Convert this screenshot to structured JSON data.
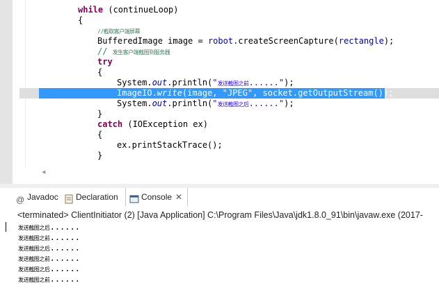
{
  "editor": {
    "lines": [
      {
        "parts": [
          {
            "t": "while",
            "c": "kw"
          },
          {
            "t": " (continueLoop)"
          }
        ]
      },
      {
        "parts": [
          {
            "t": "{"
          }
        ]
      },
      {
        "parts": [
          {
            "t": "//截取客户端屏幕",
            "c": "cm cn"
          }
        ]
      },
      {
        "parts": [
          {
            "t": "BufferedImage image = "
          },
          {
            "t": "robot",
            "c": "fd2"
          },
          {
            "t": ".createScreenCapture("
          },
          {
            "t": "rectangle",
            "c": "fd2"
          },
          {
            "t": ");"
          }
        ]
      },
      {
        "parts": [
          {
            "t": "// ",
            "c": "cm"
          },
          {
            "t": "发生客户端截图到服务器",
            "c": "cm cn"
          }
        ]
      },
      {
        "parts": [
          {
            "t": "try",
            "c": "kw"
          }
        ]
      },
      {
        "parts": [
          {
            "t": "{"
          }
        ]
      },
      {
        "parts": [
          {
            "t": "System."
          },
          {
            "t": "out",
            "c": "fd"
          },
          {
            "t": ".println("
          },
          {
            "t": "\"",
            "c": "st"
          },
          {
            "t": "发送截图之前",
            "c": "st cn"
          },
          {
            "t": "......\"",
            "c": "st"
          },
          {
            "t": ");"
          }
        ]
      },
      {
        "parts": [
          {
            "t": "ImageIO."
          },
          {
            "t": "write",
            "c": "it"
          },
          {
            "t": "(image, "
          },
          {
            "t": "\"JPEG\"",
            "c": "st"
          },
          {
            "t": ", socket.getOutputStream());"
          }
        ]
      },
      {
        "parts": [
          {
            "t": "System."
          },
          {
            "t": "out",
            "c": "fd"
          },
          {
            "t": ".println("
          },
          {
            "t": "\"",
            "c": "st"
          },
          {
            "t": "发送截图之后",
            "c": "st cn"
          },
          {
            "t": "......\"",
            "c": "st"
          },
          {
            "t": ");"
          }
        ]
      },
      {
        "parts": [
          {
            "t": "}"
          }
        ]
      },
      {
        "parts": [
          {
            "t": "catch",
            "c": "kw"
          },
          {
            "t": " (IOException ex)"
          }
        ]
      },
      {
        "parts": [
          {
            "t": "{"
          }
        ]
      },
      {
        "parts": [
          {
            "t": "ex.printStackTrace();"
          }
        ]
      },
      {
        "parts": [
          {
            "t": "}"
          }
        ]
      }
    ],
    "selected_line": 8,
    "hscroll_arrow": "◀"
  },
  "tabs": [
    {
      "label": "Javadoc",
      "icon": "at-icon"
    },
    {
      "label": "Declaration",
      "icon": "declaration-icon"
    },
    {
      "label": "Console",
      "icon": "console-icon",
      "active": true
    }
  ],
  "console": {
    "close_glyph": "✕",
    "terminated": "<terminated> ClientInitiator (2) [Java Application] C:\\Program Files\\Java\\jdk1.8.0_91\\bin\\javaw.exe (2017-",
    "output": [
      {
        "text": "发送截图之后",
        "dots": "......"
      },
      {
        "text": "发送截图之前",
        "dots": "......"
      },
      {
        "text": "发送截图之后",
        "dots": "......"
      },
      {
        "text": "发送截图之前",
        "dots": "......"
      },
      {
        "text": "发送截图之后",
        "dots": "......"
      },
      {
        "text": "发送截图之前",
        "dots": "......"
      }
    ]
  },
  "colors": {
    "keyword": "#7f0055",
    "comment": "#3f7f5f",
    "string": "#2a00ff",
    "field": "#0000c0",
    "selection": "#3399ff"
  }
}
